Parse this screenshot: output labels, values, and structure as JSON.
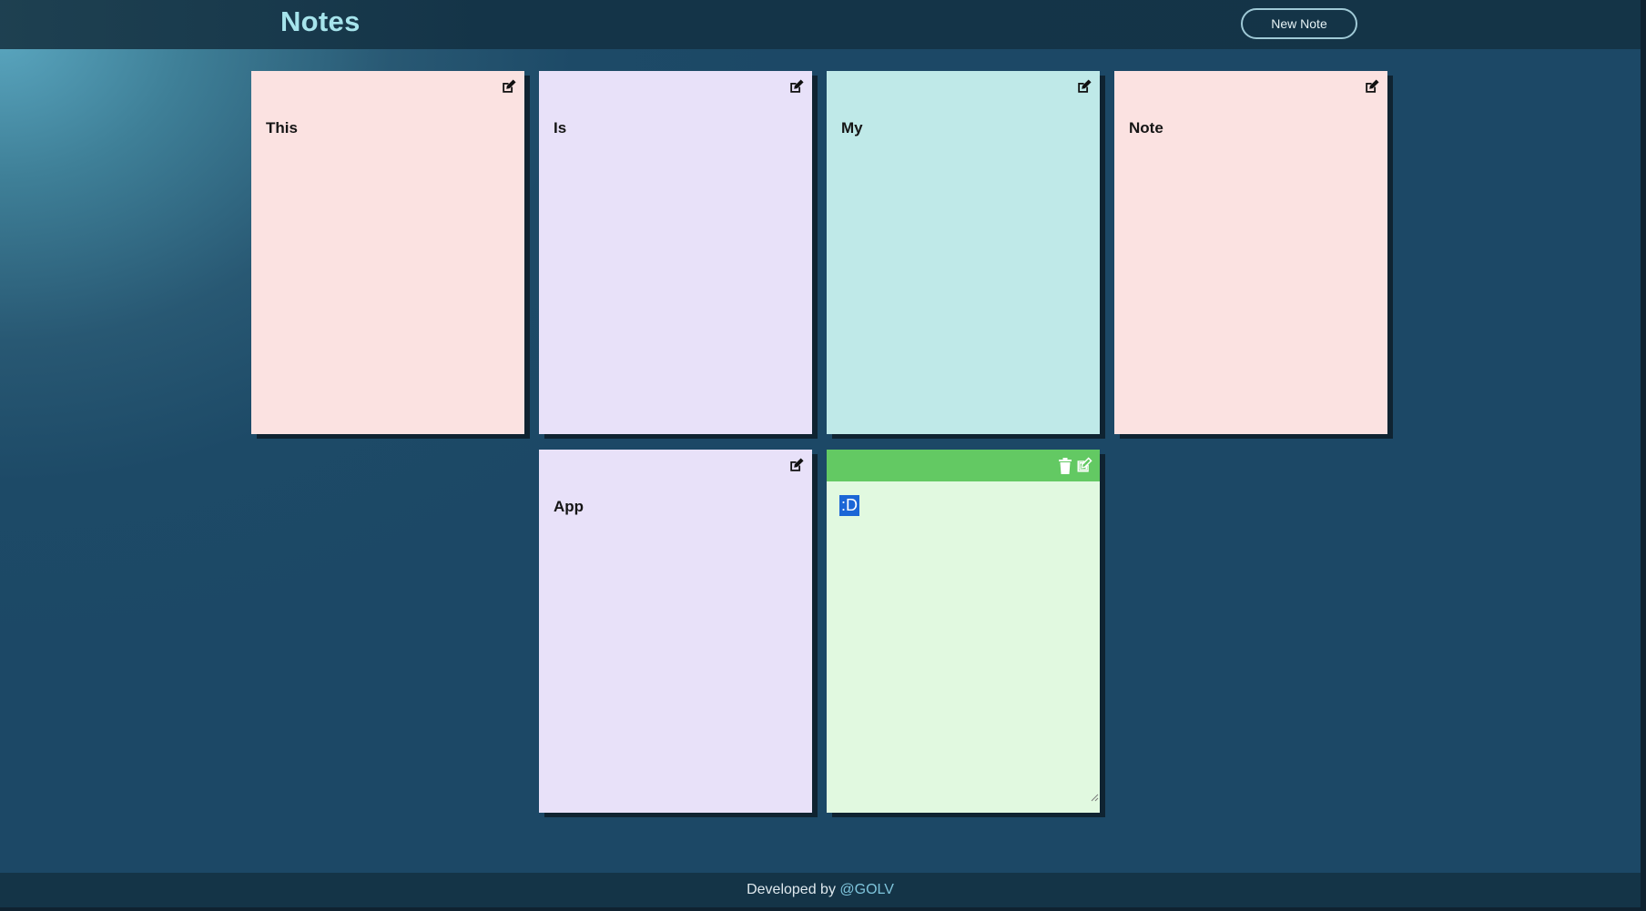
{
  "header": {
    "title": "Notes",
    "new_note_label": "New Note"
  },
  "notes": [
    {
      "text": "This",
      "color": "#fbe2e1",
      "icon": "pencil-square-icon"
    },
    {
      "text": "Is",
      "color": "#e8e1f9",
      "icon": "pencil-square-icon"
    },
    {
      "text": "My",
      "color": "#bfe9e8",
      "icon": "pencil-square-icon"
    },
    {
      "text": "Note",
      "color": "#fbe2e1",
      "icon": "pencil-square-icon"
    },
    {
      "text": "App",
      "color": "#e8e1f9",
      "icon": "pencil-square-icon"
    }
  ],
  "editing_note": {
    "selected_text": ":D",
    "bar_color": "#63c963",
    "body_color": "#e1f9e0",
    "icons": [
      "trash-icon",
      "pencil-square-icon"
    ]
  },
  "footer": {
    "prefix": "Developed by",
    "author": "@GOLV"
  },
  "colors": {
    "title": "#a6e4ec",
    "header_bg": "#143447",
    "link": "#7fc5dc"
  }
}
